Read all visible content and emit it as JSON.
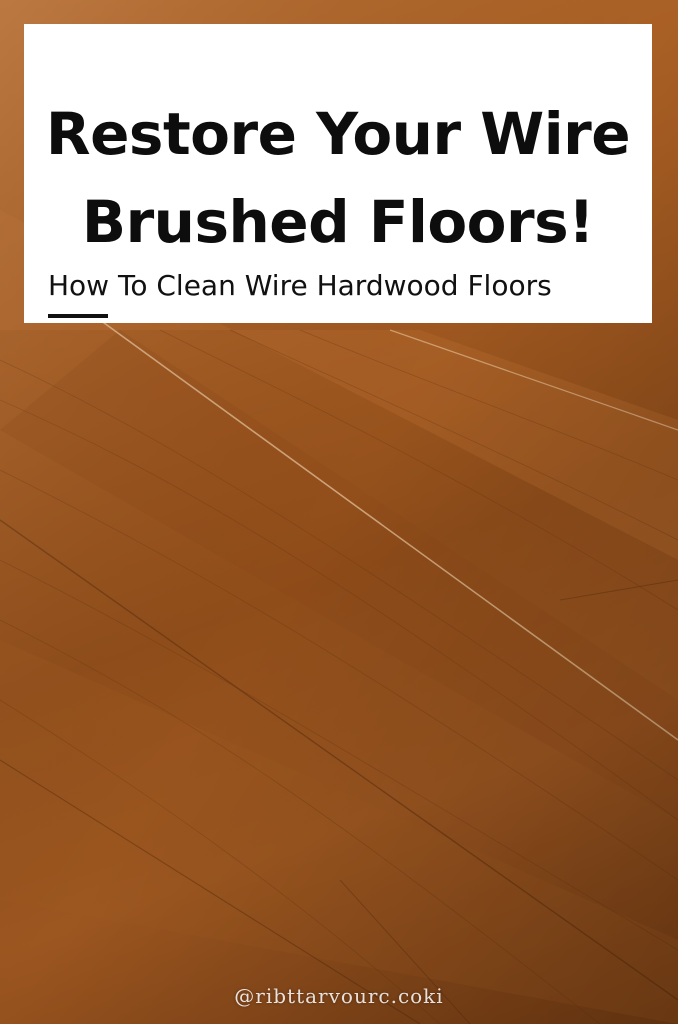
{
  "card": {
    "headline_line1": "Restore Your Wire",
    "headline_line2": "Brushed Floors!",
    "subtitle": "How To Clean Wire Hardwood Floors"
  },
  "watermark": "@ribttarvourc.coki",
  "colors": {
    "card_background": "#ffffff",
    "text": "#0d0d0d",
    "wood_light": "#b46a2c",
    "wood_dark": "#7a3f14"
  }
}
